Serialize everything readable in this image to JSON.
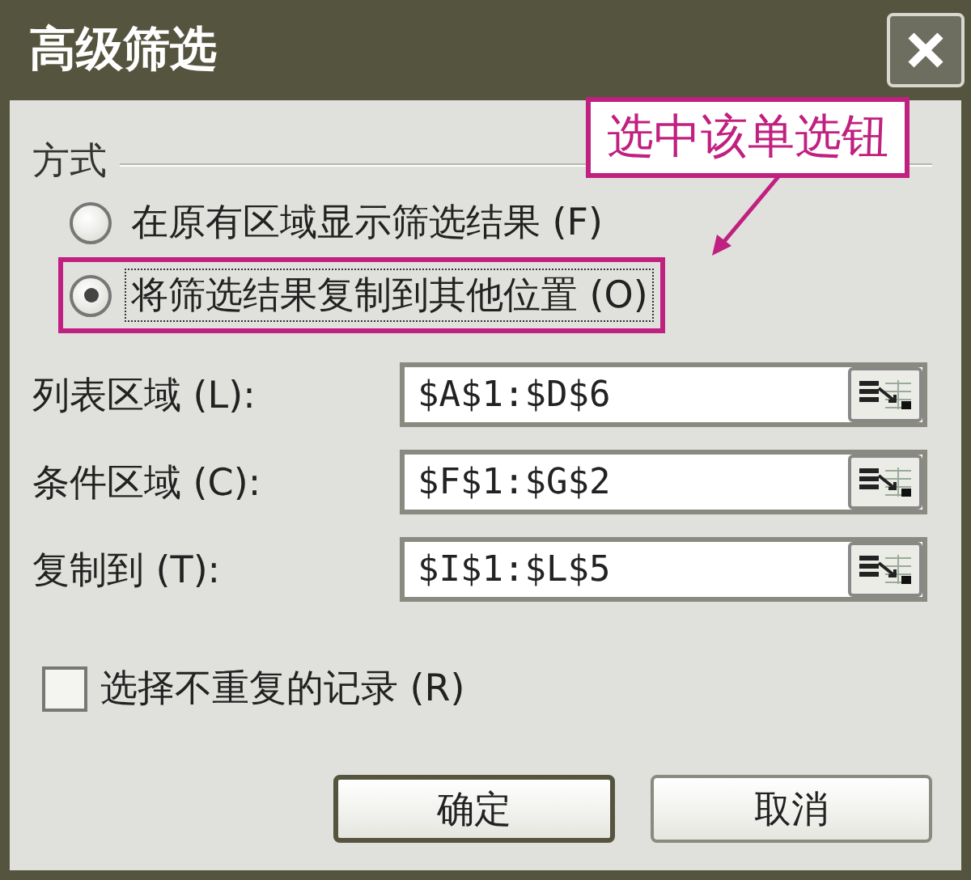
{
  "window": {
    "title": "高级筛选"
  },
  "annotation": {
    "text": "选中该单选钮"
  },
  "mode_group": {
    "label": "方式",
    "options": [
      {
        "label": "在原有区域显示筛选结果 (F)",
        "selected": false,
        "highlighted": false
      },
      {
        "label": "将筛选结果复制到其他位置 (O)",
        "selected": true,
        "highlighted": true
      }
    ]
  },
  "fields": [
    {
      "label": "列表区域 (L):",
      "value": "$A$1:$D$6"
    },
    {
      "label": "条件区域 (C):",
      "value": "$F$1:$G$2"
    },
    {
      "label": "复制到 (T):",
      "value": "$I$1:$L$5"
    }
  ],
  "unique_checkbox": {
    "label": "选择不重复的记录 (R)",
    "checked": false
  },
  "buttons": [
    {
      "label": "确定",
      "default": true
    },
    {
      "label": "取消",
      "default": false
    }
  ]
}
